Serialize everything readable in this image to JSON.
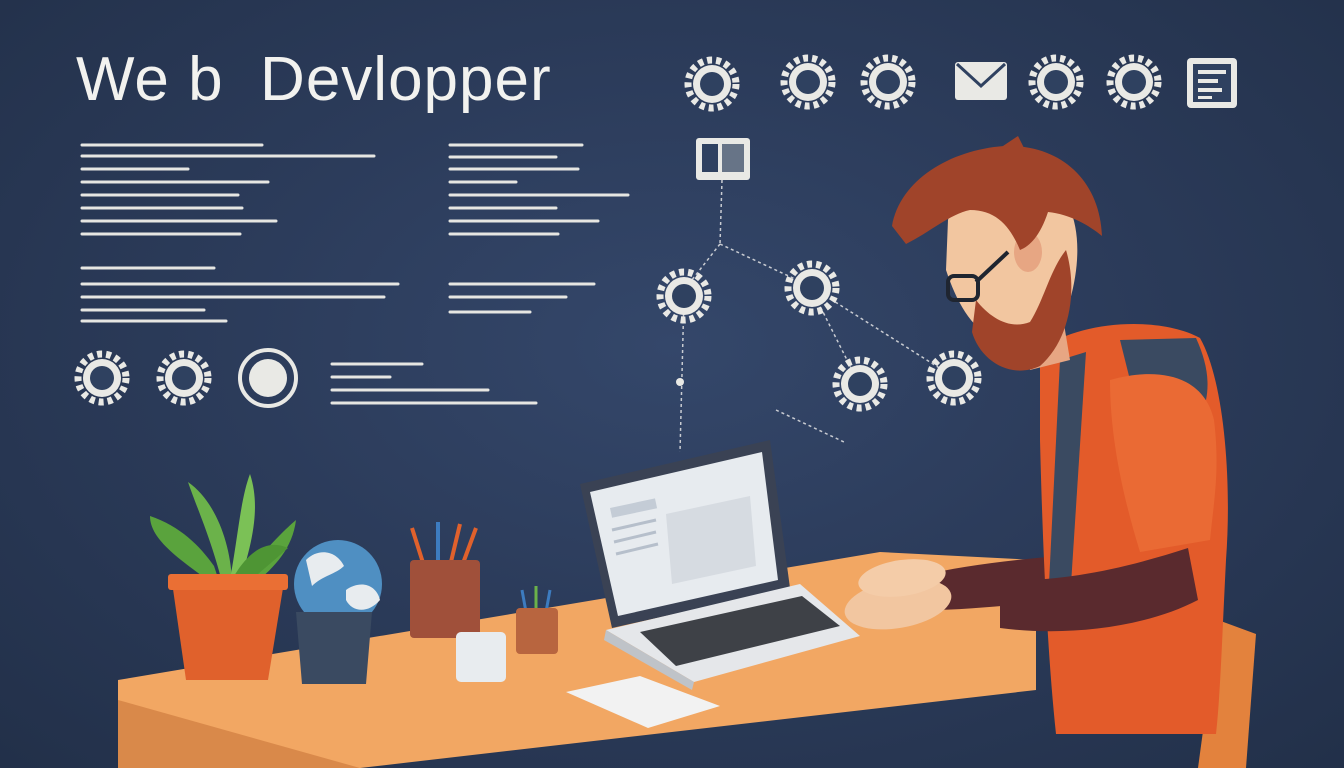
{
  "title": "We b  Devlopper",
  "colors": {
    "background": "#2c3c5b",
    "line": "#e6e6e2",
    "shirt": "#e35b2a",
    "sleeve": "#5a2a2e",
    "hair": "#a0442a",
    "desk": "#f2a763",
    "pot": "#e0612c",
    "plant": "#6bb24a",
    "globe": "#4f8fc2"
  },
  "icons": {
    "top_row": [
      "gear-icon",
      "gear-icon",
      "gear-icon",
      "mail-icon",
      "gear-icon",
      "gear-icon",
      "list-icon"
    ],
    "diagram": [
      "browser-window-icon",
      "gear-icon",
      "gear-icon",
      "gear-icon",
      "gear-icon"
    ],
    "left_row": [
      "gear-icon",
      "gear-icon",
      "circle-icon"
    ]
  }
}
